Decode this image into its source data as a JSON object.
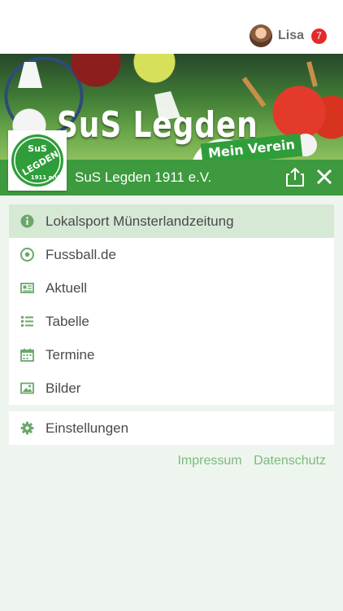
{
  "user": {
    "name": "Lisa",
    "notification_count": "7"
  },
  "banner": {
    "title": "SuS Legden",
    "tagline": "Mein Verein"
  },
  "logo": {
    "text_top": "SuS",
    "text_middle": "LEGDEN",
    "text_bottom": "1911 e.V."
  },
  "club": {
    "name": "SuS Legden 1911 e.V."
  },
  "menu": {
    "items": [
      {
        "label": "Lokalsport Münsterlandzeitung",
        "icon": "info-icon"
      },
      {
        "label": "Fussball.de",
        "icon": "soccer-ball-icon"
      },
      {
        "label": "Aktuell",
        "icon": "newspaper-icon"
      },
      {
        "label": "Tabelle",
        "icon": "list-icon"
      },
      {
        "label": "Termine",
        "icon": "calendar-icon"
      },
      {
        "label": "Bilder",
        "icon": "image-icon"
      }
    ]
  },
  "settings": {
    "label": "Einstellungen",
    "icon": "gear-icon"
  },
  "footer": {
    "impressum": "Impressum",
    "datenschutz": "Datenschutz"
  },
  "colors": {
    "brand_green": "#3d9a3e",
    "active_row": "#d5e9d5",
    "icon_green": "#6aa86a",
    "badge_red": "#e32b2b",
    "footer_link": "#7dba7d"
  }
}
